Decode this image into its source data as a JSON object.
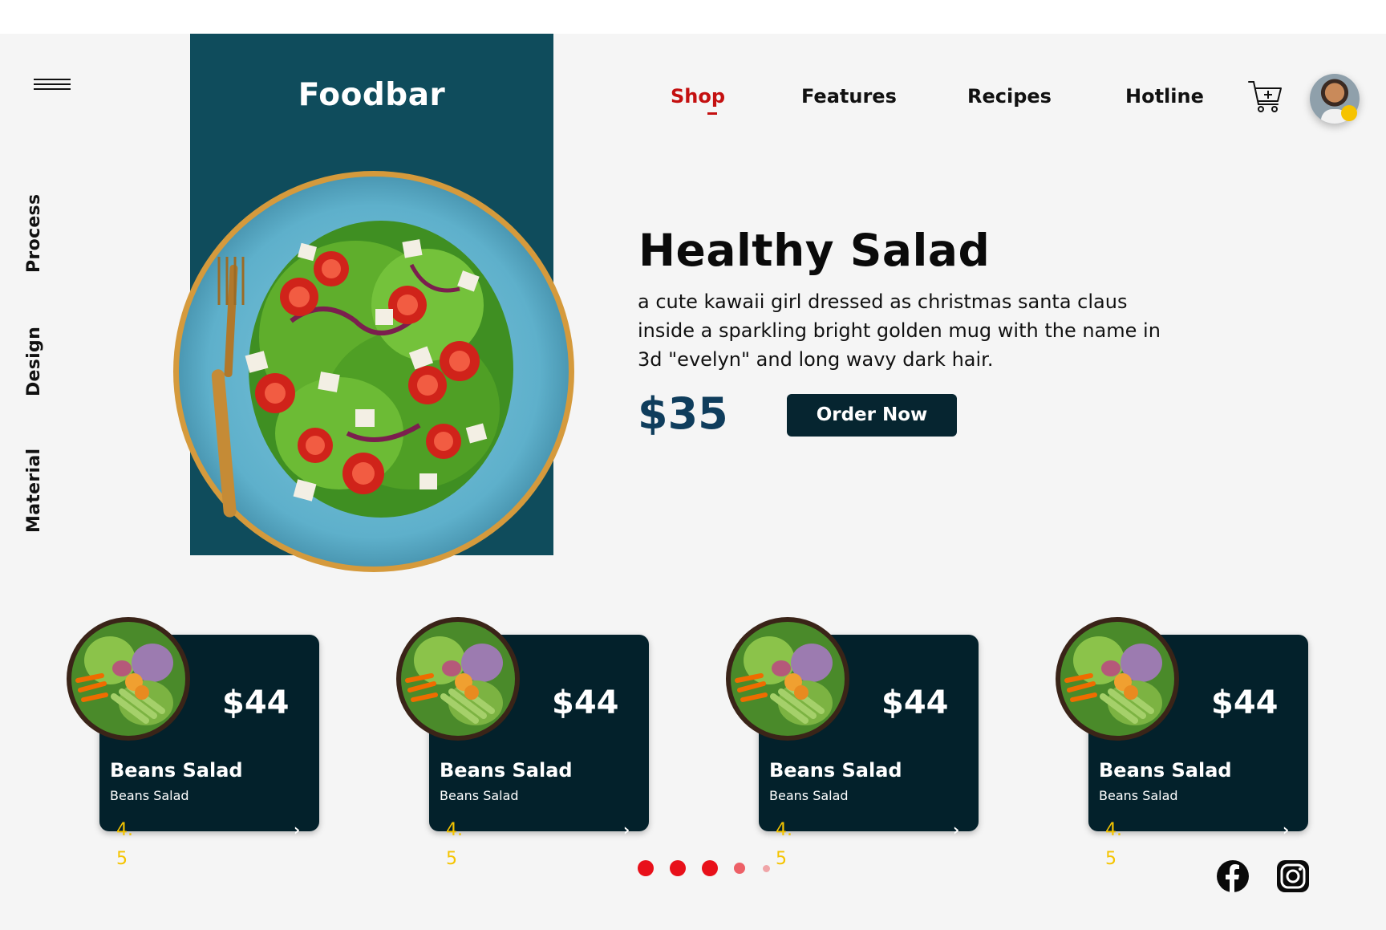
{
  "brand": "Foodbar",
  "sidebar": {
    "items": [
      "Process",
      "Design",
      "Material"
    ]
  },
  "nav": {
    "items": [
      "Shop",
      "Features",
      "Recipes",
      "Hotline"
    ],
    "active": "Shop"
  },
  "hero": {
    "title": "Healthy Salad",
    "description": "a cute kawaii girl dressed as christmas santa claus inside a sparkling bright golden mug with the name in 3d \"evelyn\" and long wavy dark hair.",
    "price": "$35",
    "cta": "Order Now"
  },
  "cards": [
    {
      "price": "$44",
      "name": "Beans Salad",
      "subtitle": "Beans Salad",
      "rating": "4.5"
    },
    {
      "price": "$44",
      "name": "Beans Salad",
      "subtitle": "Beans Salad",
      "rating": "4.5"
    },
    {
      "price": "$44",
      "name": "Beans Salad",
      "subtitle": "Beans Salad",
      "rating": "4.5"
    },
    {
      "price": "$44",
      "name": "Beans Salad",
      "subtitle": "Beans Salad",
      "rating": "4.5"
    }
  ],
  "carousel": {
    "dot_count": 5,
    "active_index": 0
  },
  "icons": [
    "menu-icon",
    "cart-icon",
    "avatar",
    "chevron-right-icon",
    "facebook-icon",
    "instagram-icon"
  ],
  "colors": {
    "panel": "#0f4c5c",
    "accent": "#c41010",
    "dark": "#062530",
    "price": "#0f3d5c",
    "rating": "#f5c400",
    "dot": "#e8101a"
  }
}
